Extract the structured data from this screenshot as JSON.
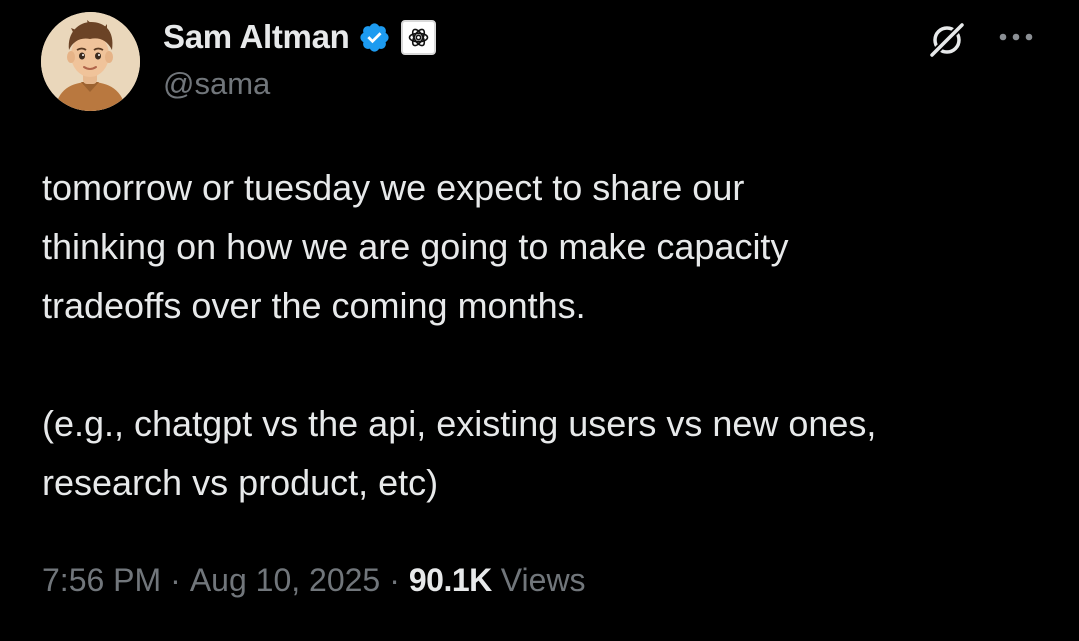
{
  "author": {
    "display_name": "Sam Altman",
    "handle": "@sama",
    "verified_badge_color": "#1d9bf0",
    "avatar_icon": "avatar-illustration",
    "affiliate_icon": "openai-logo-icon"
  },
  "actions": {
    "grok_icon": "grok-icon",
    "more_icon": "more-horizontal-icon"
  },
  "tweet": {
    "lines": [
      "tomorrow or tuesday we expect to share our",
      "thinking on how we are going to make capacity",
      "tradeoffs over the coming months.",
      "(e.g., chatgpt vs the api, existing users vs new ones,",
      "research vs product, etc)"
    ]
  },
  "meta": {
    "time": "7:56 PM",
    "separator": "·",
    "date": "Aug 10, 2025",
    "views_count": "90.1K",
    "views_label": "Views"
  },
  "colors": {
    "background": "#000000",
    "primary_text": "#e7e9ea",
    "secondary_text": "#71767b"
  }
}
